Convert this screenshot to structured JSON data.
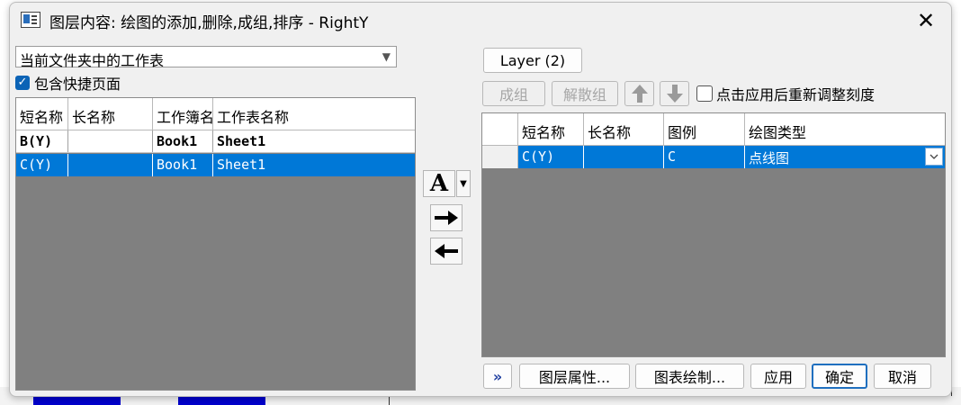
{
  "window": {
    "title": "图层内容: 绘图的添加,删除,成组,排序 - RightY"
  },
  "left": {
    "source_select": {
      "value": "当前文件夹中的工作表"
    },
    "include_shortcut": {
      "label": "包含快捷页面",
      "checked": true
    },
    "columns": [
      "短名称",
      "长名称",
      "工作簿名",
      "工作表名称"
    ],
    "rows": [
      {
        "short": "B(Y)",
        "long": "",
        "book": "Book1",
        "sheet": "Sheet1",
        "selected": false
      },
      {
        "short": "C(Y)",
        "long": "",
        "book": "Book1",
        "sheet": "Sheet1",
        "selected": true
      }
    ]
  },
  "middle": {
    "font_button_glyph": "A",
    "add_icon": "arrow-right-icon",
    "remove_icon": "arrow-left-icon"
  },
  "right": {
    "layer_button": "Layer (2)",
    "group_button": "成组",
    "ungroup_button": "解散组",
    "rescale_checkbox": {
      "label": "点击应用后重新调整刻度",
      "checked": false
    },
    "columns": [
      "",
      "短名称",
      "长名称",
      "图例",
      "绘图类型"
    ],
    "rows": [
      {
        "index": "",
        "short": "C(Y)",
        "long": "",
        "legend": "C",
        "plot_type": "点线图",
        "selected": true
      }
    ]
  },
  "footer": {
    "expand_glyph": "»",
    "layer_props": "图层属性...",
    "plot_setup": "图表绘制...",
    "apply": "应用",
    "ok": "确定",
    "cancel": "取消"
  },
  "colors": {
    "selection": "#0078d7",
    "grid_bg": "#808080",
    "dialog_bg": "#f0f0f0"
  }
}
